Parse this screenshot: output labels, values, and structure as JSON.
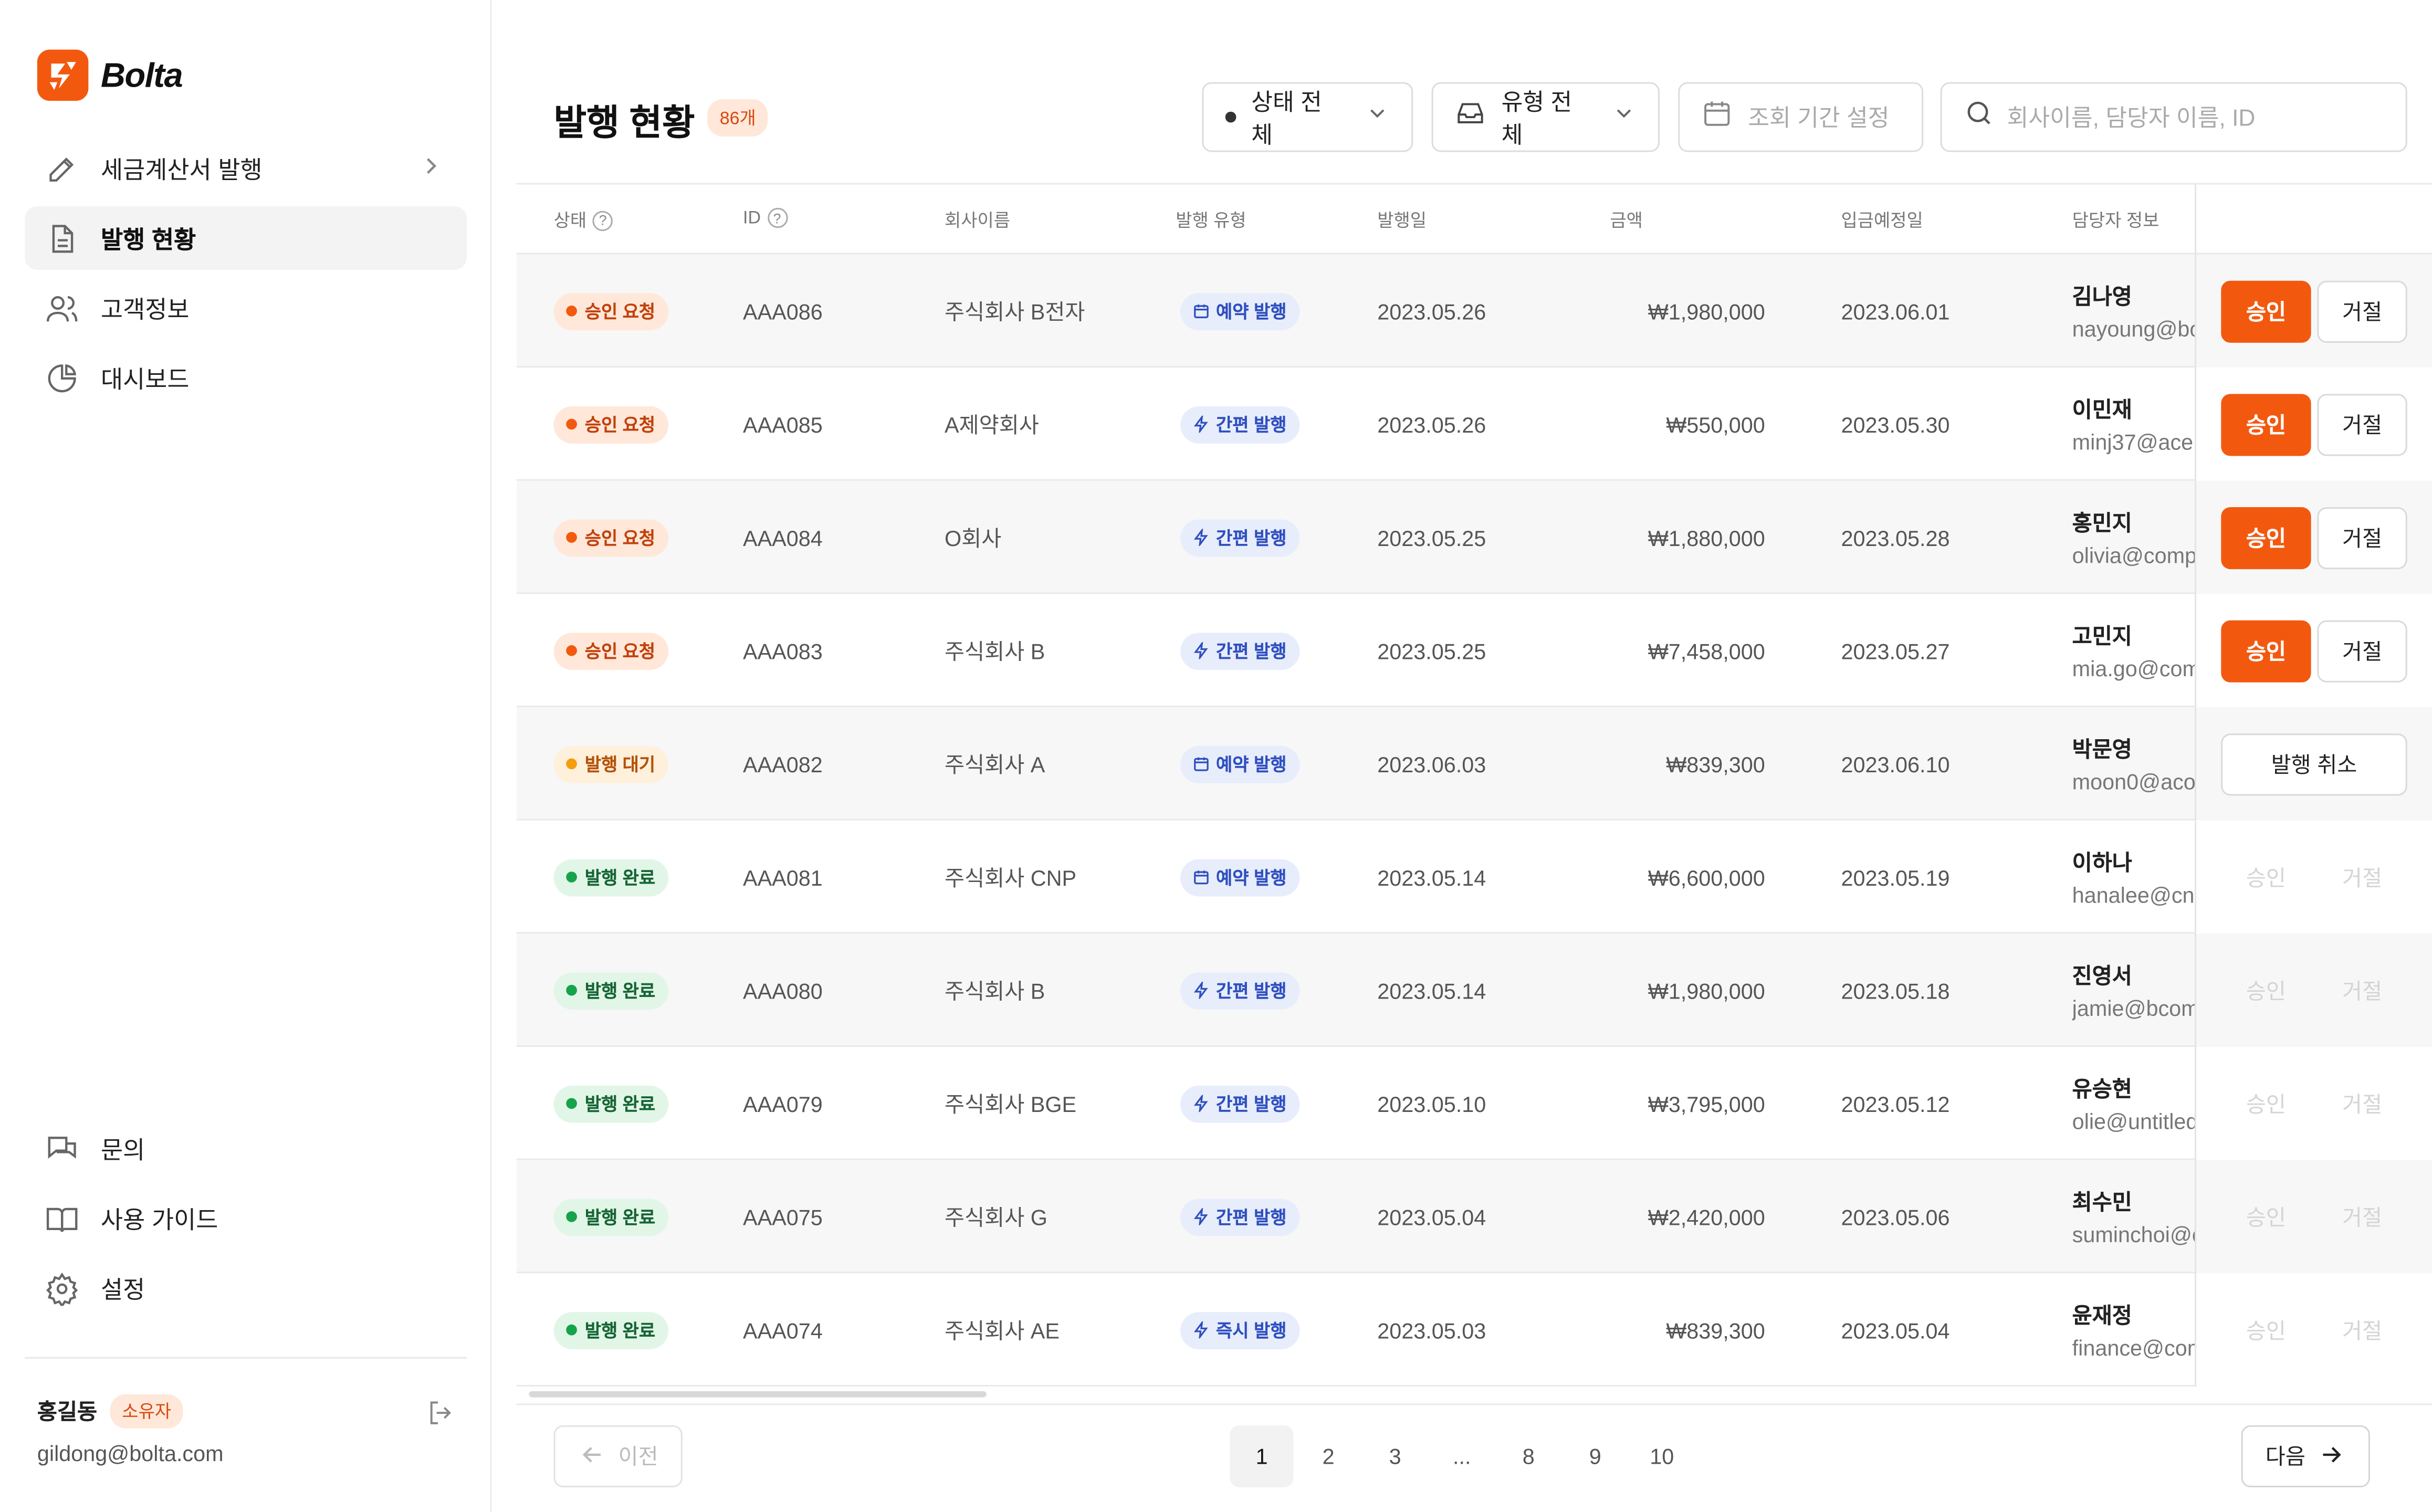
{
  "brand": {
    "name": "Bolta",
    "accent": "#f2590f"
  },
  "nav": {
    "items": [
      {
        "label": "세금계산서 발행",
        "icon": "edit-icon"
      },
      {
        "label": "발행 현황",
        "icon": "document-icon"
      },
      {
        "label": "고객정보",
        "icon": "users-icon"
      },
      {
        "label": "대시보드",
        "icon": "pie-chart-icon"
      }
    ],
    "bottom": [
      {
        "label": "문의",
        "icon": "chat-icon"
      },
      {
        "label": "사용 가이드",
        "icon": "book-icon"
      },
      {
        "label": "설정",
        "icon": "gear-icon"
      }
    ]
  },
  "user": {
    "name": "홍길동",
    "role": "소유자",
    "email": "gildong@bolta.com"
  },
  "header": {
    "title": "발행 현황",
    "count": "86개",
    "status_filter": "상태 전체",
    "type_filter": "유형 전체",
    "date_placeholder": "조회 기간 설정",
    "search_placeholder": "회사이름, 담당자 이름,  ID"
  },
  "columns": {
    "status": "상태",
    "id": "ID",
    "company": "회사이름",
    "type": "발행 유형",
    "issue_date": "발행일",
    "amount": "금액",
    "due_date": "입금예정일",
    "manager": "담당자 정보"
  },
  "buttons": {
    "approve": "승인",
    "reject": "거절",
    "cancel": "발행 취소"
  },
  "rows": [
    {
      "status": "승인 요청",
      "id": "AAA086",
      "company": "주식회사 B전자",
      "type": "예약 발행",
      "issue_date": "2023.05.26",
      "amount": "₩1,980,000",
      "due_date": "2023.06.01",
      "manager": "김나영",
      "email": "nayoung@bo"
    },
    {
      "status": "승인 요청",
      "id": "AAA085",
      "company": "A제약회사",
      "type": "간편 발행",
      "issue_date": "2023.05.26",
      "amount": "₩550,000",
      "due_date": "2023.05.30",
      "manager": "이민재",
      "email": "minj37@ace"
    },
    {
      "status": "승인 요청",
      "id": "AAA084",
      "company": "O회사",
      "type": "간편 발행",
      "issue_date": "2023.05.25",
      "amount": "₩1,880,000",
      "due_date": "2023.05.28",
      "manager": "홍민지",
      "email": "olivia@comp"
    },
    {
      "status": "승인 요청",
      "id": "AAA083",
      "company": "주식회사 B",
      "type": "간편 발행",
      "issue_date": "2023.05.25",
      "amount": "₩7,458,000",
      "due_date": "2023.05.27",
      "manager": "고민지",
      "email": "mia.go@com"
    },
    {
      "status": "발행 대기",
      "id": "AAA082",
      "company": "주식회사 A",
      "type": "예약 발행",
      "issue_date": "2023.06.03",
      "amount": "₩839,300",
      "due_date": "2023.06.10",
      "manager": "박문영",
      "email": "moon0@aco"
    },
    {
      "status": "발행 완료",
      "id": "AAA081",
      "company": "주식회사 CNP",
      "type": "예약 발행",
      "issue_date": "2023.05.14",
      "amount": "₩6,600,000",
      "due_date": "2023.05.19",
      "manager": "이하나",
      "email": "hanalee@cnp"
    },
    {
      "status": "발행 완료",
      "id": "AAA080",
      "company": "주식회사 B",
      "type": "간편 발행",
      "issue_date": "2023.05.14",
      "amount": "₩1,980,000",
      "due_date": "2023.05.18",
      "manager": "진영서",
      "email": "jamie@bcom"
    },
    {
      "status": "발행 완료",
      "id": "AAA079",
      "company": "주식회사 BGE",
      "type": "간편 발행",
      "issue_date": "2023.05.10",
      "amount": "₩3,795,000",
      "due_date": "2023.05.12",
      "manager": "유승현",
      "email": "olie@untitled"
    },
    {
      "status": "발행 완료",
      "id": "AAA075",
      "company": "주식회사 G",
      "type": "간편 발행",
      "issue_date": "2023.05.04",
      "amount": "₩2,420,000",
      "due_date": "2023.05.06",
      "manager": "최수민",
      "email": "suminchoi@c"
    },
    {
      "status": "발행 완료",
      "id": "AAA074",
      "company": "주식회사 AE",
      "type": "즉시 발행",
      "issue_date": "2023.05.03",
      "amount": "₩839,300",
      "due_date": "2023.05.04",
      "manager": "윤재정",
      "email": "finance@com"
    }
  ],
  "pagination": {
    "prev": "이전",
    "next": "다음",
    "pages": [
      "1",
      "2",
      "3",
      "...",
      "8",
      "9",
      "10"
    ],
    "current": "1"
  }
}
